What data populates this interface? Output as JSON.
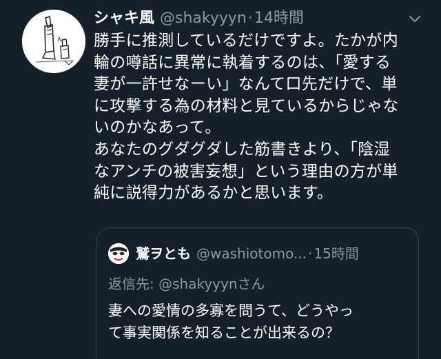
{
  "tweet": {
    "author": {
      "display_name": "シャキ風",
      "handle": "@shakyyyn",
      "avatar_icon": "sketch-avatar-icon"
    },
    "separator": "·",
    "time": "14時間",
    "menu_icon": "chevron-down-icon",
    "text_lines": [
      "勝手に推測しているだけですよ。たかが内",
      "輪の噂話に異常に執着するのは、「愛する",
      "妻が一許せなーい」なんて口先だけで、単",
      "に攻撃する為の材料と見ているからじゃな",
      "いのかなあって。",
      "あなたのグダグダした筋書きより、「陰湿",
      "なアンチの被害妄想」という理由の方が単",
      "純に説得力があるかと思います。"
    ]
  },
  "quoted": {
    "author": {
      "display_name": "鷲ヲとも",
      "handle": "@washiotomo...",
      "avatar_icon": "mask-avatar-icon"
    },
    "separator": "·",
    "time": "15時間",
    "reply_prefix": "返信先: ",
    "reply_mention": "@shakyyynさん",
    "text_lines": [
      "妻への愛情の多寡を問うて、どうやっ",
      "て事実関係を知ることが出来るの？"
    ]
  },
  "colors": {
    "background": "#15202b",
    "primary_text": "#ffffff",
    "secondary_text": "#8899a6",
    "border": "#38444d"
  }
}
